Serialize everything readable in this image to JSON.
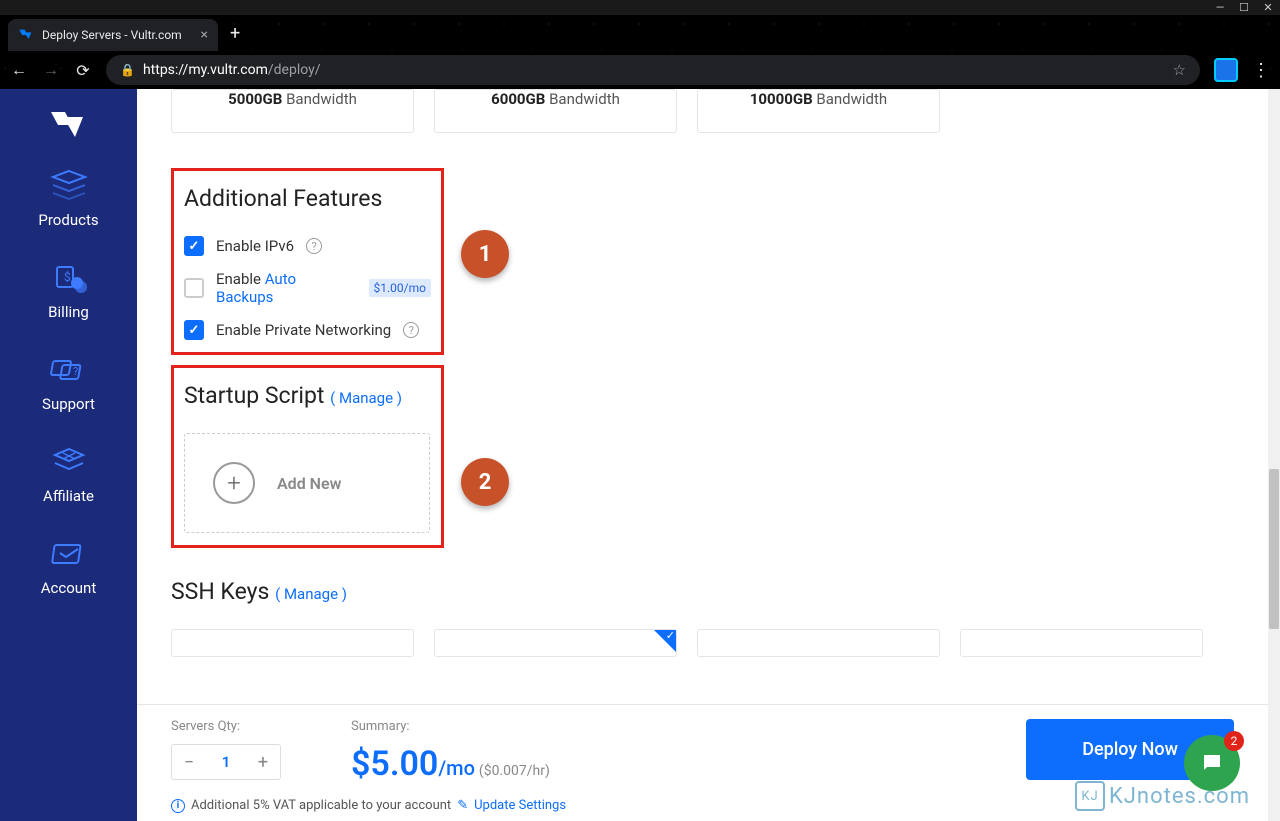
{
  "browser": {
    "tab_title": "Deploy Servers - Vultr.com",
    "url_domain": "https://my.vultr.com",
    "url_path": "/deploy/"
  },
  "sidebar": {
    "items": [
      {
        "label": "Products"
      },
      {
        "label": "Billing"
      },
      {
        "label": "Support"
      },
      {
        "label": "Affiliate"
      },
      {
        "label": "Account"
      }
    ]
  },
  "plans": [
    {
      "bw_amount": "5000GB",
      "bw_label": " Bandwidth"
    },
    {
      "bw_amount": "6000GB",
      "bw_label": " Bandwidth"
    },
    {
      "bw_amount": "10000GB",
      "bw_label": " Bandwidth"
    }
  ],
  "sections": {
    "features_title": "Additional Features",
    "features": [
      {
        "label": "Enable IPv6",
        "checked": true,
        "help": true
      },
      {
        "label_pre": "Enable ",
        "link": "Auto Backups",
        "price": "$1.00/mo",
        "checked": false
      },
      {
        "label": "Enable Private Networking",
        "checked": true,
        "help": true
      }
    ],
    "startup_title": "Startup Script",
    "startup_manage": "( Manage )",
    "add_new": "Add New",
    "ssh_title": "SSH Keys",
    "ssh_manage": "( Manage )"
  },
  "annotations": {
    "one": "1",
    "two": "2"
  },
  "footer": {
    "qty_label": "Servers Qty:",
    "qty_value": "1",
    "summary_label": "Summary:",
    "price": "$5.00",
    "price_unit": "/mo",
    "price_hr": "($0.007/hr)",
    "deploy": "Deploy Now",
    "vat_text": "Additional 5% VAT applicable to your account",
    "update_link": "Update Settings"
  },
  "chat_badge": "2",
  "watermark": "KJnotes.com",
  "watermark_box": "KJ"
}
